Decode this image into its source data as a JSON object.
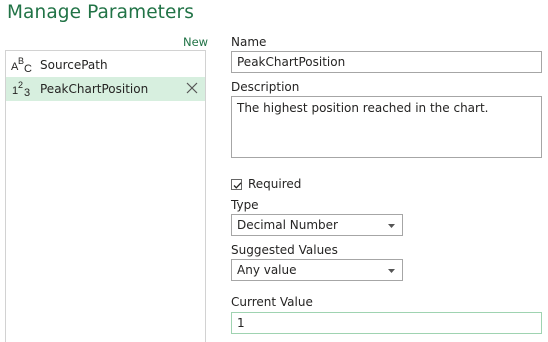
{
  "dialog": {
    "title": "Manage Parameters"
  },
  "list": {
    "new_label": "New",
    "items": [
      {
        "name": "SourcePath",
        "type_icon": "text-type-icon",
        "selected": false
      },
      {
        "name": "PeakChartPosition",
        "type_icon": "number-type-icon",
        "selected": true
      }
    ]
  },
  "form": {
    "name_label": "Name",
    "name_value": "PeakChartPosition",
    "description_label": "Description",
    "description_value": "The highest position reached in the chart.",
    "required_label": "Required",
    "required_checked": true,
    "type_label": "Type",
    "type_value": "Decimal Number",
    "suggested_label": "Suggested Values",
    "suggested_value": "Any value",
    "current_label": "Current Value",
    "current_value": "1"
  },
  "colors": {
    "accent": "#217346",
    "selected_bg": "#d7efdf",
    "border": "#a6a6a6"
  }
}
